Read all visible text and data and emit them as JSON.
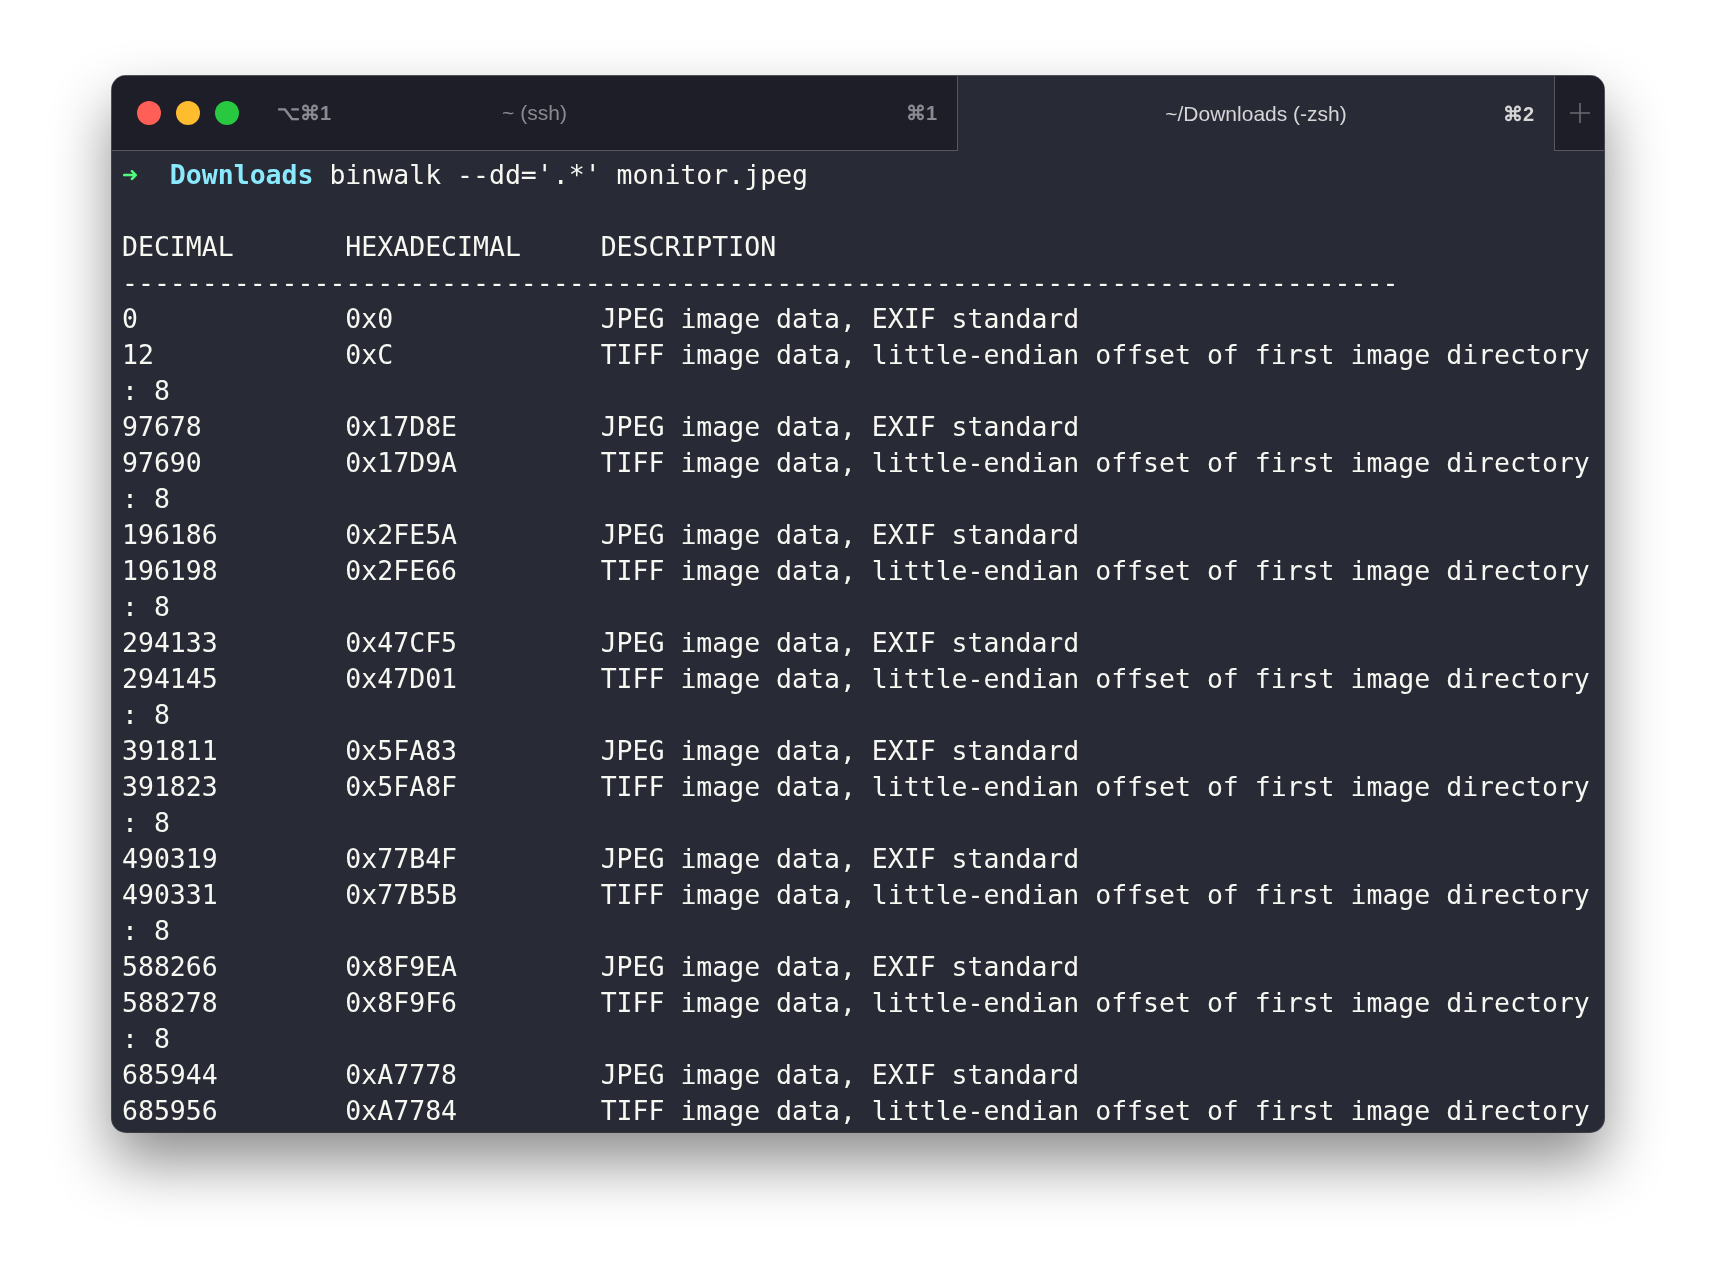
{
  "window": {
    "hotkey": "⌥⌘1",
    "tabs": [
      {
        "title": "~ (ssh)",
        "shortcut": "⌘1",
        "selected": false
      },
      {
        "title": "~/Downloads (-zsh)",
        "shortcut": "⌘2",
        "selected": true
      }
    ]
  },
  "prompt": {
    "arrow": "➜",
    "directory": "Downloads",
    "command": "binwalk --dd='.*' monitor.jpeg"
  },
  "table": {
    "columns": [
      "DECIMAL",
      "HEXADECIMAL",
      "DESCRIPTION"
    ],
    "rule": "--------------------------------------------------------------------------------",
    "rows": [
      {
        "decimal": "0",
        "hexadecimal": "0x0",
        "description": "JPEG image data, EXIF standard"
      },
      {
        "decimal": "12",
        "hexadecimal": "0xC",
        "description": "TIFF image data, little-endian offset of first image directory",
        "wrap": ": 8"
      },
      {
        "decimal": "97678",
        "hexadecimal": "0x17D8E",
        "description": "JPEG image data, EXIF standard"
      },
      {
        "decimal": "97690",
        "hexadecimal": "0x17D9A",
        "description": "TIFF image data, little-endian offset of first image directory",
        "wrap": ": 8"
      },
      {
        "decimal": "196186",
        "hexadecimal": "0x2FE5A",
        "description": "JPEG image data, EXIF standard"
      },
      {
        "decimal": "196198",
        "hexadecimal": "0x2FE66",
        "description": "TIFF image data, little-endian offset of first image directory",
        "wrap": ": 8"
      },
      {
        "decimal": "294133",
        "hexadecimal": "0x47CF5",
        "description": "JPEG image data, EXIF standard"
      },
      {
        "decimal": "294145",
        "hexadecimal": "0x47D01",
        "description": "TIFF image data, little-endian offset of first image directory",
        "wrap": ": 8"
      },
      {
        "decimal": "391811",
        "hexadecimal": "0x5FA83",
        "description": "JPEG image data, EXIF standard"
      },
      {
        "decimal": "391823",
        "hexadecimal": "0x5FA8F",
        "description": "TIFF image data, little-endian offset of first image directory",
        "wrap": ": 8"
      },
      {
        "decimal": "490319",
        "hexadecimal": "0x77B4F",
        "description": "JPEG image data, EXIF standard"
      },
      {
        "decimal": "490331",
        "hexadecimal": "0x77B5B",
        "description": "TIFF image data, little-endian offset of first image directory",
        "wrap": ": 8"
      },
      {
        "decimal": "588266",
        "hexadecimal": "0x8F9EA",
        "description": "JPEG image data, EXIF standard"
      },
      {
        "decimal": "588278",
        "hexadecimal": "0x8F9F6",
        "description": "TIFF image data, little-endian offset of first image directory",
        "wrap": ": 8"
      },
      {
        "decimal": "685944",
        "hexadecimal": "0xA7778",
        "description": "JPEG image data, EXIF standard"
      },
      {
        "decimal": "685956",
        "hexadecimal": "0xA7784",
        "description": "TIFF image data, little-endian offset of first image directory"
      }
    ]
  }
}
